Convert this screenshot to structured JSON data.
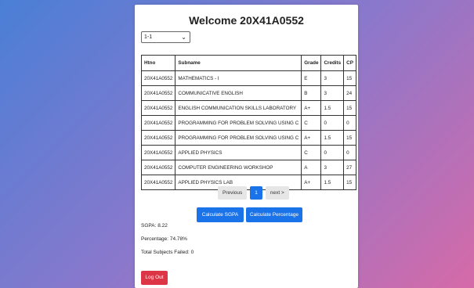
{
  "header": {
    "title": "Welcome 20X41A0552"
  },
  "semester_select": {
    "value": "1-1"
  },
  "table": {
    "headers": [
      "Htno",
      "Subname",
      "Grade",
      "Credits",
      "CP"
    ],
    "rows": [
      [
        "20X41A0552",
        "MATHEMATICS - I",
        "E",
        "3",
        "15"
      ],
      [
        "20X41A0552",
        "COMMUNICATIVE ENGLISH",
        "B",
        "3",
        "24"
      ],
      [
        "20X41A0552",
        "ENGLISH COMMUNICATION SKILLS LABORATORY",
        "A+",
        "1.5",
        "15"
      ],
      [
        "20X41A0552",
        "PROGRAMMING FOR PROBLEM SOLVING USING C",
        "C",
        "0",
        "0"
      ],
      [
        "20X41A0552",
        "PROGRAMMING FOR PROBLEM SOLVING USING C",
        "A+",
        "1.5",
        "15"
      ],
      [
        "20X41A0552",
        "APPLIED PHYSICS",
        "C",
        "0",
        "0"
      ],
      [
        "20X41A0552",
        "COMPUTER ENGINEERING WORKSHOP",
        "A",
        "3",
        "27"
      ],
      [
        "20X41A0552",
        "APPLIED PHYSICS LAB",
        "A+",
        "1.5",
        "15"
      ]
    ]
  },
  "pagination": {
    "prev_label": "Previous",
    "current": "1",
    "next_label": "next >"
  },
  "actions": {
    "sgpa_label": "Calculate SGPA",
    "percentage_label": "Calculate Percentage"
  },
  "stats": {
    "sgpa": "SGPA: 8.22",
    "percentage": "Percentage: 74.78%",
    "failed": "Total Subjects Failed: 0"
  },
  "logout_label": "Log Out",
  "colors": {
    "primary": "#1a73e8",
    "danger": "#dc3545",
    "pager_bg": "#e6e6e6"
  }
}
